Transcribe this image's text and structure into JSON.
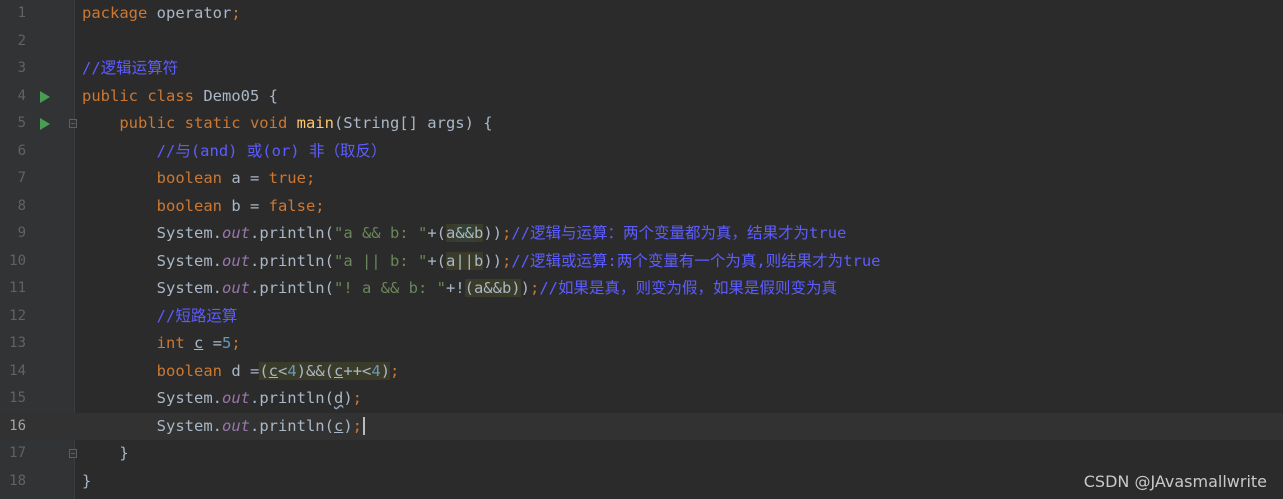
{
  "editor": {
    "lines": [
      {
        "num": "1",
        "tokens": [
          [
            "kw",
            "package"
          ],
          [
            "plain",
            " operator"
          ],
          [
            "kw",
            ";"
          ]
        ]
      },
      {
        "num": "2",
        "tokens": []
      },
      {
        "num": "3",
        "tokens": [
          [
            "cmt",
            "//逻辑运算符"
          ]
        ]
      },
      {
        "num": "4",
        "run": true,
        "tokens": [
          [
            "kw",
            "public class "
          ],
          [
            "plain",
            "Demo05 {"
          ]
        ]
      },
      {
        "num": "5",
        "run": true,
        "fold": true,
        "tokens": [
          [
            "plain",
            "    "
          ],
          [
            "kw",
            "public static void "
          ],
          [
            "fn",
            "main"
          ],
          [
            "plain",
            "(String[] args) {"
          ]
        ]
      },
      {
        "num": "6",
        "tokens": [
          [
            "plain",
            "        "
          ],
          [
            "cmt",
            "//与(and) 或(or) 非（取反）"
          ]
        ]
      },
      {
        "num": "7",
        "tokens": [
          [
            "plain",
            "        "
          ],
          [
            "kw",
            "boolean "
          ],
          [
            "plain",
            "a = "
          ],
          [
            "kw",
            "true;"
          ]
        ]
      },
      {
        "num": "8",
        "tokens": [
          [
            "plain",
            "        "
          ],
          [
            "kw",
            "boolean "
          ],
          [
            "plain",
            "b = "
          ],
          [
            "kw",
            "false;"
          ]
        ]
      },
      {
        "num": "9",
        "tokens": [
          [
            "plain",
            "        System."
          ],
          [
            "field",
            "out"
          ],
          [
            "plain",
            ".println("
          ],
          [
            "str",
            "\"a && b: \""
          ],
          [
            "plain",
            "+("
          ],
          [
            "hl",
            "a"
          ],
          [
            "hl2",
            "&&"
          ],
          [
            "hl",
            "b"
          ],
          [
            "plain",
            "))"
          ],
          [
            "kw",
            ";"
          ],
          [
            "cmt",
            "//逻辑与运算：两个变量都为真，结果才为true"
          ]
        ]
      },
      {
        "num": "10",
        "tokens": [
          [
            "plain",
            "        System."
          ],
          [
            "field",
            "out"
          ],
          [
            "plain",
            ".println("
          ],
          [
            "str",
            "\"a || b: \""
          ],
          [
            "plain",
            "+("
          ],
          [
            "hl",
            "a||b"
          ],
          [
            "plain",
            "))"
          ],
          [
            "kw",
            ";"
          ],
          [
            "cmt",
            "//逻辑或运算:两个变量有一个为真,则结果才为true"
          ]
        ]
      },
      {
        "num": "11",
        "tokens": [
          [
            "plain",
            "        System."
          ],
          [
            "field",
            "out"
          ],
          [
            "plain",
            ".println("
          ],
          [
            "str",
            "\"! a && b: \""
          ],
          [
            "plain",
            "+!"
          ],
          [
            "hl",
            "(a&&b)"
          ],
          [
            "plain",
            ")"
          ],
          [
            "kw",
            ";"
          ],
          [
            "cmt",
            "//如果是真，则变为假，如果是假则变为真"
          ]
        ]
      },
      {
        "num": "12",
        "tokens": [
          [
            "plain",
            "        "
          ],
          [
            "cmt",
            "//短路运算"
          ]
        ]
      },
      {
        "num": "13",
        "tokens": [
          [
            "plain",
            "        "
          ],
          [
            "kw",
            "int "
          ],
          [
            "ul",
            "c"
          ],
          [
            "plain",
            " ="
          ],
          [
            "num",
            "5"
          ],
          [
            "kw",
            ";"
          ]
        ]
      },
      {
        "num": "14",
        "tokens": [
          [
            "plain",
            "        "
          ],
          [
            "kw",
            "boolean "
          ],
          [
            "plain",
            "d ="
          ],
          [
            "hl",
            "("
          ],
          [
            "hlul",
            "c"
          ],
          [
            "hl",
            "<"
          ],
          [
            "hlnum",
            "4"
          ],
          [
            "hl",
            ")&&("
          ],
          [
            "hlul",
            "c"
          ],
          [
            "hl",
            "++<"
          ],
          [
            "hlnum",
            "4"
          ],
          [
            "hl",
            ")"
          ],
          [
            "kw",
            ";"
          ]
        ]
      },
      {
        "num": "15",
        "tokens": [
          [
            "plain",
            "        System."
          ],
          [
            "field",
            "out"
          ],
          [
            "plain",
            ".println("
          ],
          [
            "wavy",
            "d"
          ],
          [
            "plain",
            ")"
          ],
          [
            "kw",
            ";"
          ]
        ]
      },
      {
        "num": "16",
        "current": true,
        "caret": true,
        "tokens": [
          [
            "plain",
            "        System."
          ],
          [
            "field",
            "out"
          ],
          [
            "plain",
            ".println("
          ],
          [
            "ul",
            "c"
          ],
          [
            "plain",
            ")"
          ],
          [
            "kw",
            ";"
          ]
        ]
      },
      {
        "num": "17",
        "fold": true,
        "tokens": [
          [
            "plain",
            "    }"
          ]
        ]
      },
      {
        "num": "18",
        "tokens": [
          [
            "plain",
            "}"
          ]
        ]
      }
    ]
  },
  "watermark": "CSDN @JAvasmallwrite",
  "colors": {
    "background": "#2b2b2b",
    "keyword": "#cc7832",
    "string": "#6a8759",
    "comment": "#5d5dff",
    "number": "#6897bb",
    "function": "#ffc66d",
    "field": "#9876aa",
    "text": "#a9b7c6"
  }
}
